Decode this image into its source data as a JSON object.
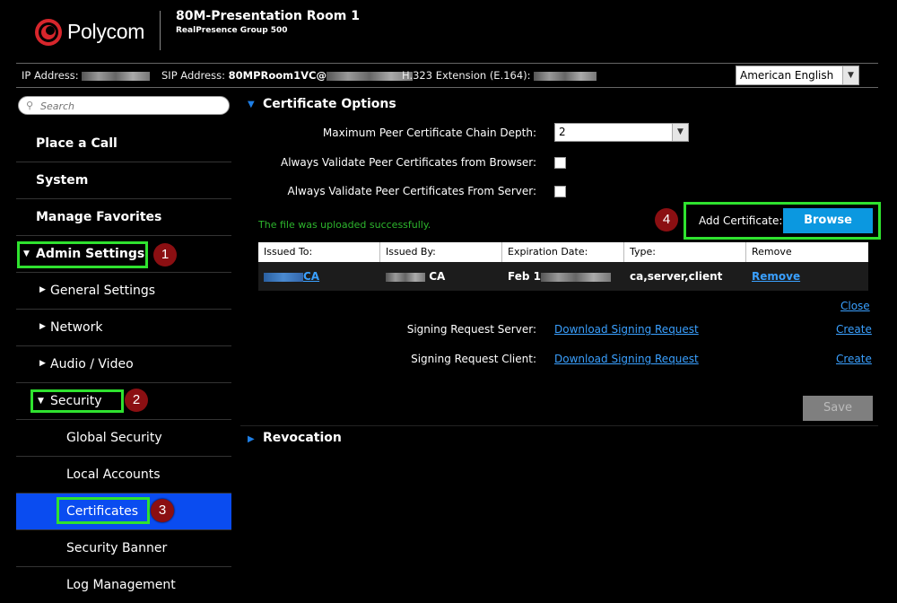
{
  "header": {
    "brand": "Polycom",
    "room_name": "80M-Presentation Room 1",
    "model": "RealPresence Group 500"
  },
  "info_bar": {
    "ip_label": "IP Address:",
    "sip_label": "SIP Address:",
    "sip_value_visible": "80MPRoom1VC@",
    "h323_label": "H.323 Extension (E.164):",
    "language": "American English"
  },
  "sidebar": {
    "search_placeholder": "Search",
    "items": [
      {
        "label": "Place a Call"
      },
      {
        "label": "System"
      },
      {
        "label": "Manage Favorites"
      },
      {
        "label": "Admin Settings"
      },
      {
        "label": "General Settings"
      },
      {
        "label": "Network"
      },
      {
        "label": "Audio / Video"
      },
      {
        "label": "Security"
      },
      {
        "label": "Global Security"
      },
      {
        "label": "Local Accounts"
      },
      {
        "label": "Certificates"
      },
      {
        "label": "Security Banner"
      },
      {
        "label": "Log Management"
      }
    ]
  },
  "callouts": [
    "1",
    "2",
    "3",
    "4"
  ],
  "main": {
    "certificate_options_title": "Certificate Options",
    "chain_depth_label": "Maximum Peer Certificate Chain Depth:",
    "chain_depth_value": "2",
    "validate_browser_label": "Always Validate Peer Certificates from Browser:",
    "validate_server_label": "Always Validate Peer Certificates From Server:",
    "upload_message": "The file was uploaded successfully.",
    "add_certificate_label": "Add Certificate:",
    "browse_label": "Browse",
    "table": {
      "headers": [
        "Issued To:",
        "Issued By:",
        "Expiration Date:",
        "Type:",
        "Remove"
      ],
      "row": {
        "issued_to": "CA",
        "issued_by": "CA",
        "expiration": "Feb 1",
        "type": "ca,server,client",
        "remove": "Remove"
      }
    },
    "close_label": "Close",
    "signing_server_label": "Signing Request Server:",
    "signing_client_label": "Signing Request Client:",
    "download_label": "Download Signing Request",
    "create_label": "Create",
    "save_label": "Save",
    "revocation_title": "Revocation"
  },
  "colors": {
    "highlight": "#2fe22f",
    "callout": "#8b0f12",
    "active_nav": "#0a4cf0",
    "browse": "#0b98e0",
    "link": "#3aa0ff",
    "success": "#2db52d"
  }
}
